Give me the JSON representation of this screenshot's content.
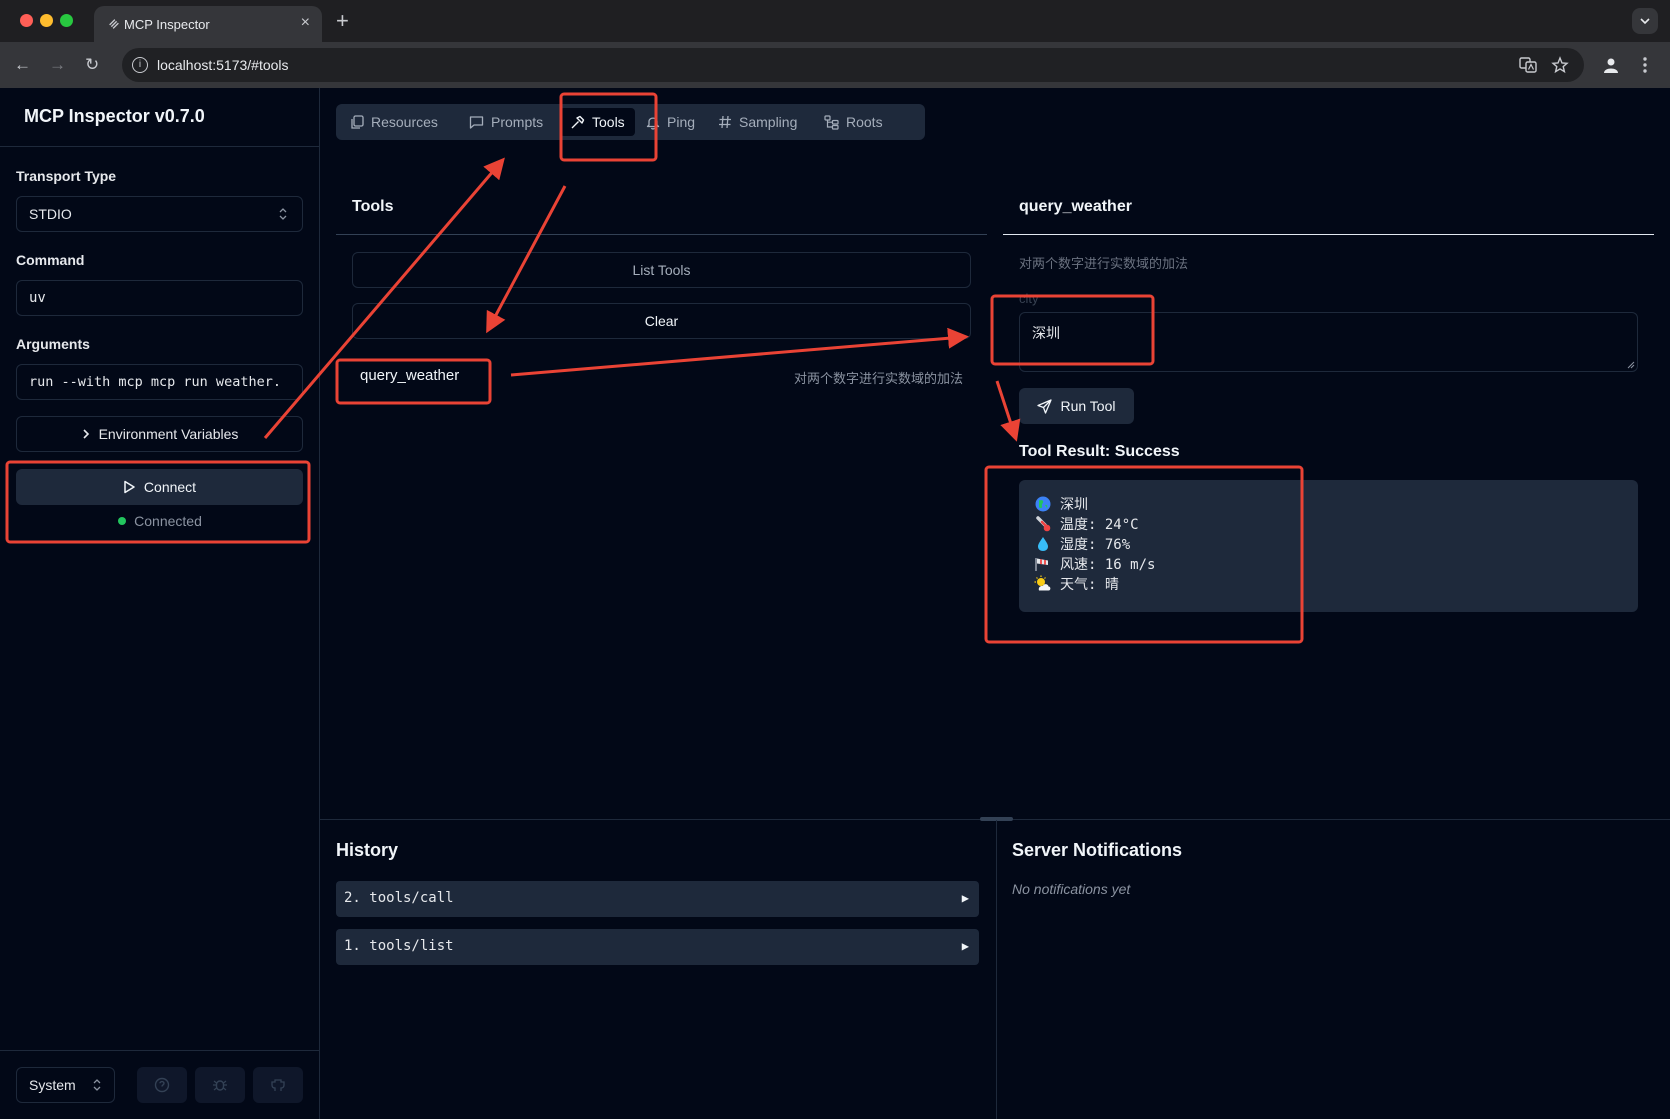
{
  "browser": {
    "tab_title": "MCP Inspector",
    "url": "localhost:5173/#tools"
  },
  "sidebar": {
    "app_title": "MCP Inspector v0.7.0",
    "transport_label": "Transport Type",
    "transport_value": "STDIO",
    "command_label": "Command",
    "command_value": "uv",
    "arguments_label": "Arguments",
    "arguments_value": "run --with mcp mcp run weather.",
    "env_button": "Environment Variables",
    "connect_button": "Connect",
    "status": "Connected",
    "status_color": "#22c55e",
    "theme_value": "System"
  },
  "tabs": [
    {
      "label": "Resources",
      "icon": "files-icon"
    },
    {
      "label": "Prompts",
      "icon": "message-square-icon"
    },
    {
      "label": "Tools",
      "icon": "hammer-icon",
      "active": true
    },
    {
      "label": "Ping",
      "icon": "bell-icon"
    },
    {
      "label": "Sampling",
      "icon": "hash-icon"
    },
    {
      "label": "Roots",
      "icon": "folder-tree-icon"
    }
  ],
  "tools_panel": {
    "title": "Tools",
    "list_button": "List Tools",
    "clear_button": "Clear",
    "items": [
      {
        "name": "query_weather",
        "description": "对两个数字进行实数域的加法"
      }
    ]
  },
  "tool_detail": {
    "title": "query_weather",
    "description": "对两个数字进行实数域的加法",
    "param_label": "city",
    "param_value": "深圳",
    "run_button": "Run Tool",
    "result_title": "Tool Result: Success",
    "result_lines": [
      {
        "icon": "globe-icon",
        "text": "深圳"
      },
      {
        "icon": "thermometer-icon",
        "text": "温度: 24°C"
      },
      {
        "icon": "droplet-icon",
        "text": "湿度: 76%"
      },
      {
        "icon": "wind-icon",
        "text": "风速: 16 m/s"
      },
      {
        "icon": "sun-cloud-icon",
        "text": "天气: 晴"
      }
    ]
  },
  "history": {
    "title": "History",
    "items": [
      "2. tools/call",
      "1. tools/list"
    ]
  },
  "notifications": {
    "title": "Server Notifications",
    "empty": "No notifications yet"
  },
  "colors": {
    "annotation": "#ea4335",
    "background": "#020817",
    "surface": "#1e293b"
  }
}
